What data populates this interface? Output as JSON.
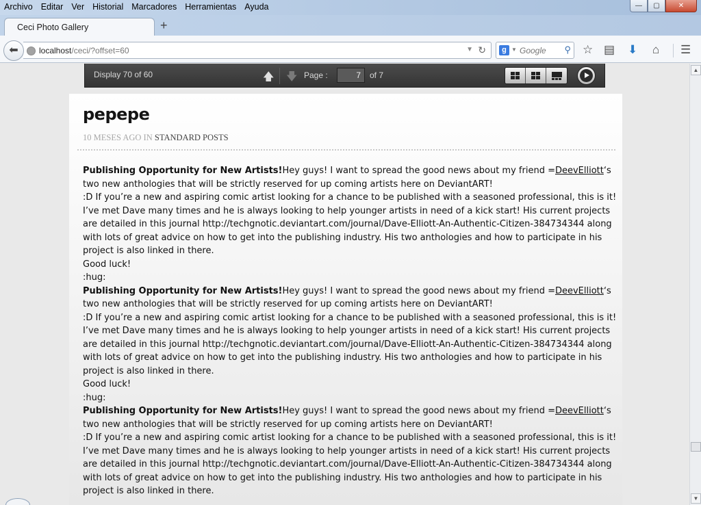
{
  "menu": [
    "Archivo",
    "Editar",
    "Ver",
    "Historial",
    "Marcadores",
    "Herramientas",
    "Ayuda"
  ],
  "window_controls": {
    "minimize": "—",
    "maximize": "▢",
    "close": "✕"
  },
  "tab": {
    "title": "Ceci Photo Gallery",
    "new_tab": "+"
  },
  "address": {
    "host": "localhost",
    "path": "/ceci/?offset=60"
  },
  "search": {
    "engine_icon": "g-icon",
    "placeholder": "Google"
  },
  "toolbar_icons": [
    "star-icon",
    "reading-list-icon",
    "download-icon",
    "home-icon",
    "menu-icon"
  ],
  "gallery": {
    "display": "Display 70 of 60",
    "page_label": "Page :",
    "page_value": "7",
    "page_total": "of 7"
  },
  "post": {
    "title": "pepepe",
    "meta_prefix": "10 meses ago in",
    "category": "Standard Posts",
    "entries": [
      {
        "bold": "Publishing Opportunity for New Artists!",
        "intro_before": "Hey guys! I want to spread the good news about my friend =",
        "user": "DeevElliott",
        "intro_after": "‘s two new anthologies that will be strictly reserved for up coming artists here on DeviantART!",
        "line2": ":D If you’re a new and aspiring comic artist looking for a chance to be published with a seasoned professional, this is it!",
        "line3": "I’ve met Dave many times and he is always looking to help younger artists in need of a kick start! His current projects are detailed in this journal http://techgnotic.deviantart.com/journal/Dave-Elliott-An-Authentic-Citizen-384734344 along with lots of great advice on how to get into the publishing industry. His two anthologies and how to participate in his project is also linked in there.",
        "line4": "Good luck!",
        "line5": ":hug:"
      },
      {
        "bold": "Publishing Opportunity for New Artists!",
        "intro_before": "Hey guys! I want to spread the good news about my friend =",
        "user": "DeevElliott",
        "intro_after": "‘s two new anthologies that will be strictly reserved for up coming artists here on DeviantART!",
        "line2": ":D If you’re a new and aspiring comic artist looking for a chance to be published with a seasoned professional, this is it!",
        "line3": "I’ve met Dave many times and he is always looking to help younger artists in need of a kick start! His current projects are detailed in this journal http://techgnotic.deviantart.com/journal/Dave-Elliott-An-Authentic-Citizen-384734344 along with lots of great advice on how to get into the publishing industry. His two anthologies and how to participate in his project is also linked in there.",
        "line4": "Good luck!",
        "line5": ":hug:"
      },
      {
        "bold": "Publishing Opportunity for New Artists!",
        "intro_before": "Hey guys! I want to spread the good news about my friend =",
        "user": "DeevElliott",
        "intro_after": "‘s two new anthologies that will be strictly reserved for up coming artists here on DeviantART!",
        "line2": ":D If you’re a new and aspiring comic artist looking for a chance to be published with a seasoned professional, this is it!",
        "line3": "I’ve met Dave many times and he is always looking to help younger artists in need of a kick start! His current projects are detailed in this journal http://techgnotic.deviantart.com/journal/Dave-Elliott-An-Authentic-Citizen-384734344 along with lots of great advice on how to get into the publishing industry. His two anthologies and how to participate in his project is also linked in there.",
        "line4": "",
        "line5": ""
      }
    ]
  },
  "colors": {
    "gallery_bar": "#3f3f3f",
    "page_bg": "#e9e9e9",
    "chrome": "#b6cbe4"
  }
}
